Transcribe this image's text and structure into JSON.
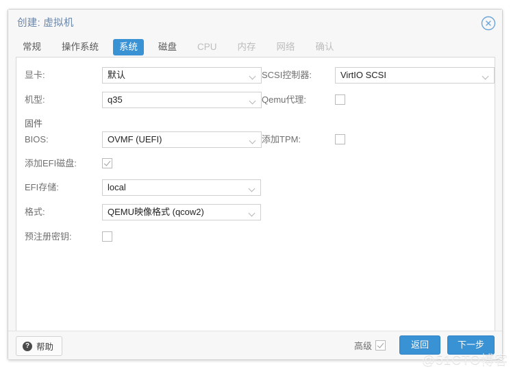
{
  "dialog": {
    "title": "创建: 虚拟机",
    "close_icon": "close-circle-icon"
  },
  "tabs": [
    {
      "label": "常规",
      "state": "normal"
    },
    {
      "label": "操作系统",
      "state": "normal"
    },
    {
      "label": "系统",
      "state": "active"
    },
    {
      "label": "磁盘",
      "state": "normal"
    },
    {
      "label": "CPU",
      "state": "disabled"
    },
    {
      "label": "内存",
      "state": "disabled"
    },
    {
      "label": "网络",
      "state": "disabled"
    },
    {
      "label": "确认",
      "state": "disabled"
    }
  ],
  "form": {
    "left": {
      "graphics_card": {
        "label": "显卡:",
        "value": "默认"
      },
      "machine_type": {
        "label": "机型:",
        "value": "q35"
      },
      "firmware_header": {
        "label": "固件"
      },
      "bios": {
        "label": "BIOS:",
        "value": "OVMF (UEFI)"
      },
      "add_efi_disk": {
        "label": "添加EFI磁盘:",
        "checked": true
      },
      "efi_storage": {
        "label": "EFI存储:",
        "value": "local"
      },
      "format": {
        "label": "格式:",
        "value": "QEMU映像格式 (qcow2)"
      },
      "pre_enroll_keys": {
        "label": "预注册密钥:",
        "checked": false
      }
    },
    "right": {
      "scsi_controller": {
        "label": "SCSI控制器:",
        "value": "VirtIO SCSI"
      },
      "qemu_agent": {
        "label": "Qemu代理:",
        "checked": false
      },
      "add_tpm": {
        "label": "添加TPM:",
        "checked": false
      }
    }
  },
  "footer": {
    "help_label": "帮助",
    "help_icon": "question-mark-icon",
    "advanced_label": "高级",
    "advanced_checked": true,
    "back_label": "返回",
    "next_label": "下一步"
  },
  "watermark": "@51CTO博客",
  "colors": {
    "accent": "#3892d4",
    "title": "#6b86a8",
    "label": "#6f6f6f",
    "disabled_tab": "#bdbdbd",
    "panel_bg": "#f7f7f7"
  }
}
